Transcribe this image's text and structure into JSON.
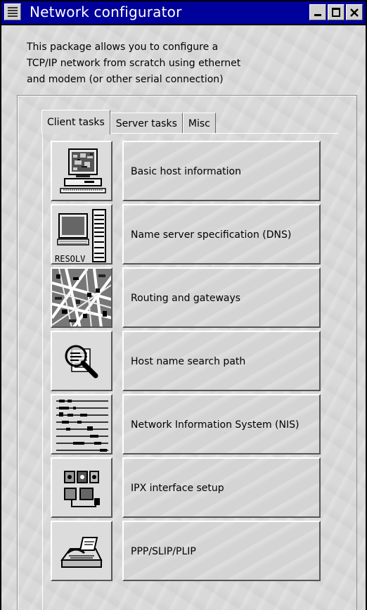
{
  "window": {
    "title": "Network configurator"
  },
  "description": {
    "line1": "This package allows you to configure a",
    "line2": "TCP/IP network from scratch using ethernet",
    "line3": "and modem (or other serial connection)"
  },
  "tabs": [
    {
      "label": "Client tasks",
      "active": true
    },
    {
      "label": "Server tasks",
      "active": false
    },
    {
      "label": "Misc",
      "active": false
    }
  ],
  "tasks": [
    {
      "label": "Basic host information",
      "icon": "workstation-icon"
    },
    {
      "label": "Name server specification (DNS)",
      "icon": "resolv-icon",
      "icon_text": "RESOLV"
    },
    {
      "label": "Routing and gateways",
      "icon": "map-icon"
    },
    {
      "label": "Host name search path",
      "icon": "magnifier-icon"
    },
    {
      "label": "Network Information System (NIS)",
      "icon": "nis-icon"
    },
    {
      "label": "IPX interface setup",
      "icon": "ipx-icon"
    },
    {
      "label": "PPP/SLIP/PLIP",
      "icon": "modem-icon"
    }
  ],
  "colors": {
    "titlebar": "#00009a",
    "background": "#d9d9d9"
  }
}
